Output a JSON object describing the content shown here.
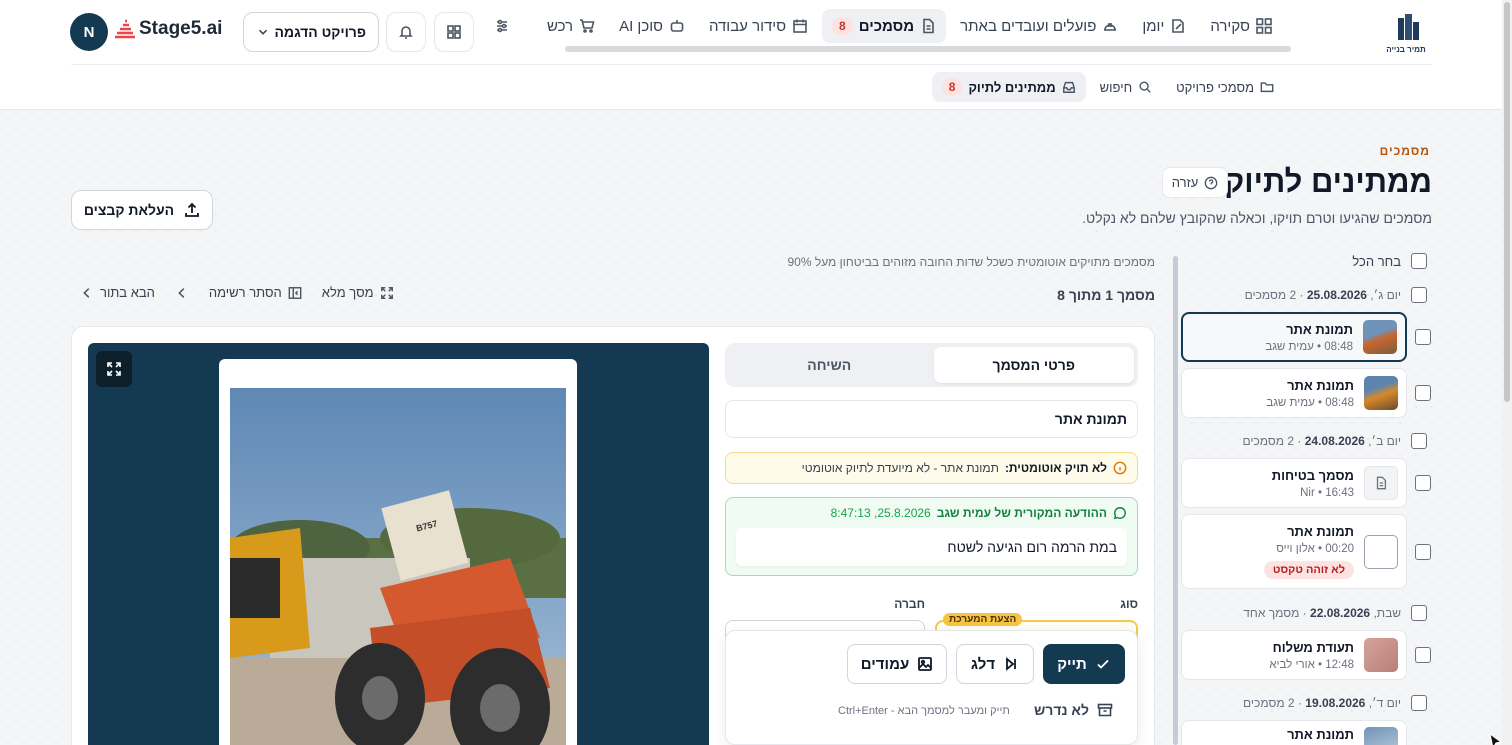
{
  "app": {
    "logo_text": "Stage5.ai",
    "user_initial": "N",
    "project_selector": "פרויקט הדגמה",
    "brand_caption": "תמיר בנייה"
  },
  "nav": {
    "items": [
      {
        "label": "סקירה",
        "icon": "grid-icon"
      },
      {
        "label": "יומן",
        "icon": "edit-icon"
      },
      {
        "label": "פועלים ועובדים באתר",
        "icon": "hardhat-icon"
      },
      {
        "label": "מסמכים",
        "icon": "document-icon",
        "badge": "8",
        "active": true
      },
      {
        "label": "סידור עבודה",
        "icon": "calendar-icon"
      },
      {
        "label": "סוכן AI",
        "icon": "robot-icon"
      },
      {
        "label": "רכש",
        "icon": "cart-icon"
      }
    ]
  },
  "subnav": {
    "project_docs": "מסמכי פרויקט",
    "search": "חיפוש",
    "pending": "ממתינים לתיוק",
    "pending_count": "8"
  },
  "page": {
    "eyebrow": "מסמכים",
    "title": "ממתינים לתיוק",
    "help": "עזרה",
    "subtitle": "מסמכים שהגיעו וטרם תויקו, וכאלה שהקובץ שלהם לא נקלט.",
    "upload": "העלאת קבצים"
  },
  "list": {
    "select_all": "בחר הכל",
    "auto_note": "מסמכים מתויקים אוטומטית כשכל שדות החובה מזוהים בביטחון מעל 90%",
    "groups": [
      {
        "day": "יום ג׳,",
        "date": "25.08.2026",
        "count": "· 2 מסמכים"
      },
      {
        "day": "יום ב׳,",
        "date": "24.08.2026",
        "count": "· 2 מסמכים"
      },
      {
        "day": "שבת,",
        "date": "22.08.2026",
        "count": "· מסמך אחד"
      },
      {
        "day": "יום ד׳,",
        "date": "19.08.2026",
        "count": "· 2 מסמכים"
      }
    ],
    "items": [
      {
        "title": "תמונת אתר",
        "meta": "08:48 • עמית שגב"
      },
      {
        "title": "תמונת אתר",
        "meta": "08:48 • עמית שגב"
      },
      {
        "title": "מסמך בטיחות",
        "meta": "Nir • 16:43"
      },
      {
        "title": "תמונת אתר",
        "meta": "00:20 • אלון וייס",
        "tag": "לא זוהה טקסט"
      },
      {
        "title": "תעודת משלוח",
        "meta": "12:48 • אורי לביא"
      },
      {
        "title": "תמונת אתר",
        "meta": ""
      }
    ]
  },
  "viewer": {
    "counter": "מסמך 1 מתוך 8",
    "fullscreen": "מסך מלא",
    "hide_list": "הסתר רשימה",
    "next": "הבא בתור",
    "tabs": [
      "פרטי המסמך",
      "השיחה"
    ],
    "doc_title": "תמונת אתר",
    "warn_bold": "לא תויק אוטומטית:",
    "warn_text": "תמונת אתר - לא מיועדת לתיוק אוטומטי",
    "msg_header": "ההודעה המקורית של עמית שגב",
    "msg_time": "25.8.2026, 8:47:13",
    "msg_body": "במת הרמה רום הגיעה לשטח",
    "field_type": "סוג",
    "field_company": "חברה",
    "suggest": "הצעת המערכת",
    "btn_file": "תייק",
    "btn_skip": "דלג",
    "btn_pages": "עמודים",
    "not_needed": "לא נדרש",
    "shortcut": "תייק ומעבר למסמך הבא - Ctrl+Enter",
    "photo_code": "B757"
  },
  "colors": {
    "navy": "#143a52",
    "accent": "#b45309",
    "danger": "#dc2626",
    "green": "#16a34a"
  }
}
